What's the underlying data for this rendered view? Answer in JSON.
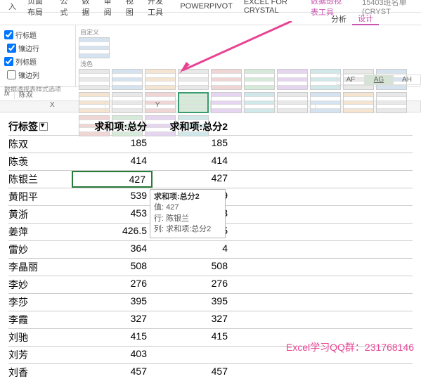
{
  "ribbon": {
    "tabs": [
      "入",
      "页面布局",
      "公式",
      "数据",
      "审阅",
      "视图",
      "开发工具",
      "POWERPIVOT",
      "EXCEL FOR CRYSTAL"
    ],
    "tools": "数据透视表工具",
    "doc": "15403班名单(CRYST",
    "sub": [
      "分析",
      "设计"
    ]
  },
  "options": {
    "rowHeader": "行标题",
    "stripeRow": "镶边行",
    "colHeader": "列标题",
    "stripeCol": "镶边列",
    "caption": "数据透视表样式选项",
    "custom": "自定义",
    "light": "浅色"
  },
  "fx": {
    "label": "fx",
    "val": "陈双"
  },
  "cols": {
    "x": "X",
    "y": "Y",
    "af": "AF",
    "ag": "AG",
    "ah": "AH"
  },
  "table": {
    "h1": "行标签",
    "h2": "求和项:总分",
    "h3": "求和项:总分2",
    "rows": [
      {
        "n": "陈双",
        "a": "185",
        "b": "185"
      },
      {
        "n": "陈羡",
        "a": "414",
        "b": "414"
      },
      {
        "n": "陈银兰",
        "a": "427",
        "b": "427",
        "sel": true
      },
      {
        "n": "黄阳平",
        "a": "539",
        "b": "9"
      },
      {
        "n": "黄浙",
        "a": "453",
        "b": "3"
      },
      {
        "n": "姜萍",
        "a": "426.5",
        "b": "5"
      },
      {
        "n": "雷妙",
        "a": "364",
        "b": "4"
      },
      {
        "n": "李晶丽",
        "a": "508",
        "b": "508"
      },
      {
        "n": "李妙",
        "a": "276",
        "b": "276"
      },
      {
        "n": "李莎",
        "a": "395",
        "b": "395"
      },
      {
        "n": "李霞",
        "a": "327",
        "b": "327"
      },
      {
        "n": "刘驰",
        "a": "415",
        "b": "415"
      },
      {
        "n": "刘芳",
        "a": "403",
        "b": ""
      },
      {
        "n": "刘香",
        "a": "457",
        "b": "457"
      }
    ]
  },
  "tooltip": {
    "h": "求和项:总分2",
    "v": "值: 427",
    "r": "行: 陈银兰",
    "c": "列: 求和项:总分2"
  },
  "watermark": "Excel学习QQ群：231768146"
}
